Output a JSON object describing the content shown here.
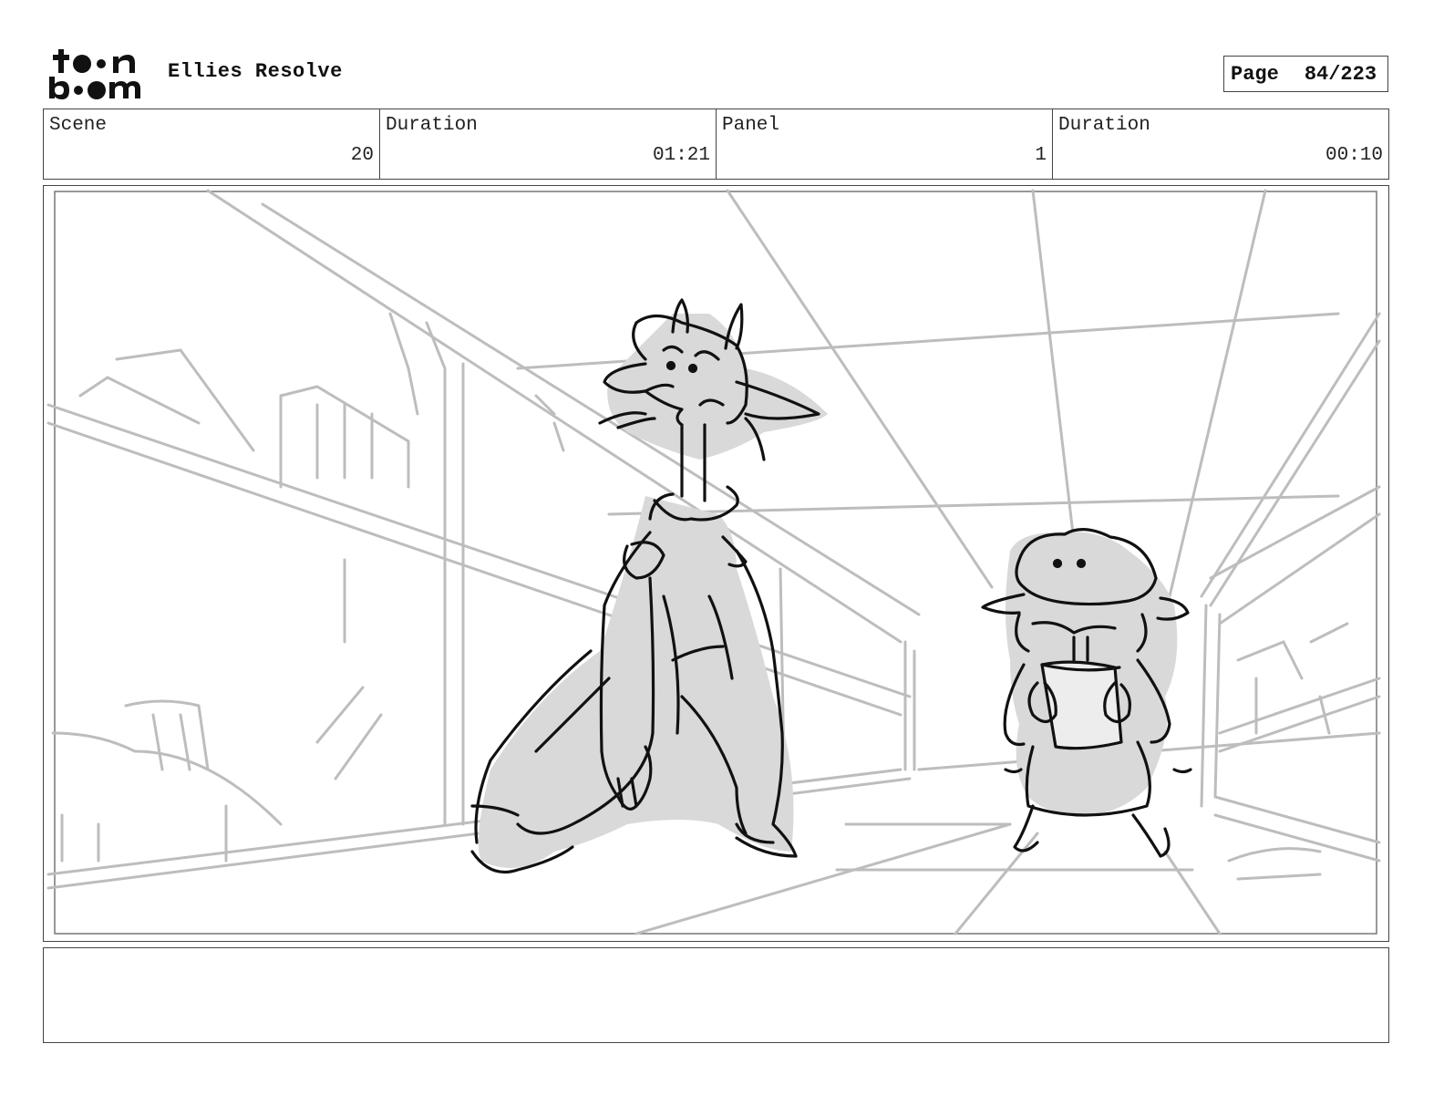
{
  "header": {
    "logo_text": "toon boom",
    "project_title": "Ellies Resolve",
    "page_label": "Page",
    "page_value": "84/223"
  },
  "info": {
    "scene_label": "Scene",
    "scene_value": "20",
    "scene_duration_label": "Duration",
    "scene_duration_value": "01:21",
    "panel_label": "Panel",
    "panel_value": "1",
    "panel_duration_label": "Duration",
    "panel_duration_value": "00:10"
  },
  "notes": {
    "text": ""
  }
}
